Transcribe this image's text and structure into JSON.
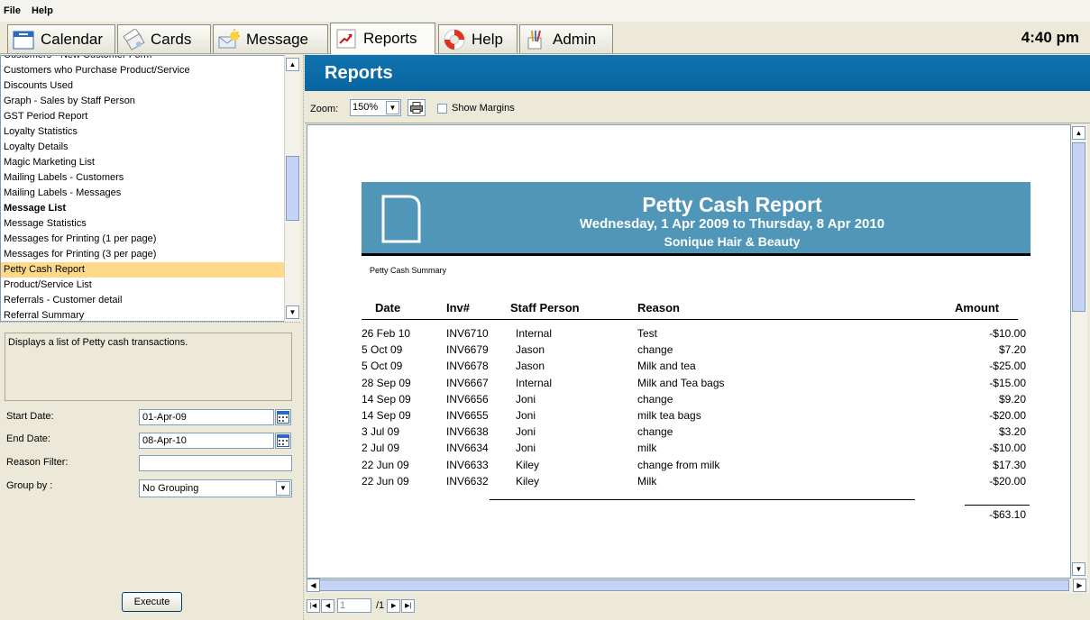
{
  "menu": [
    "File",
    "Help"
  ],
  "tabs": [
    {
      "label": "Calendar",
      "icon": "calendar-icon"
    },
    {
      "label": "Cards",
      "icon": "cards-icon"
    },
    {
      "label": "Message",
      "icon": "message-icon"
    },
    {
      "label": "Reports",
      "icon": "reports-icon",
      "active": true
    },
    {
      "label": "Help",
      "icon": "lifebuoy-icon"
    },
    {
      "label": "Admin",
      "icon": "admin-icon"
    }
  ],
  "clock": "4:40 pm",
  "report_list": [
    "Customers - New Customer Form",
    "Customers who Purchase Product/Service",
    "Discounts Used",
    "Graph - Sales by Staff Person",
    "GST Period Report",
    "Loyalty Statistics",
    "Loyalty Details",
    "Magic Marketing List",
    "Mailing Labels - Customers",
    "Mailing Labels - Messages",
    "Message List",
    "Message Statistics",
    "Messages for Printing (1 per page)",
    "Messages for Printing (3 per page)",
    "Petty Cash Report",
    "Product/Service List",
    "Referrals - Customer detail",
    "Referral Summary"
  ],
  "selected_report": "Petty Cash Report",
  "description": "Displays a list of Petty cash transactions.",
  "form": {
    "start_label": "Start Date:",
    "start_value": "01-Apr-09",
    "end_label": "End Date:",
    "end_value": "08-Apr-10",
    "reason_label": "Reason Filter:",
    "reason_value": "",
    "group_label": "Group by :",
    "group_value": "No Grouping"
  },
  "execute_label": "Execute",
  "reports_title": "Reports",
  "zoom": {
    "label": "Zoom:",
    "value": "150%",
    "margins_label": "Show Margins"
  },
  "pager": {
    "page": "1",
    "of": "/1"
  },
  "report": {
    "title": "Petty Cash Report",
    "daterange": "Wednesday, 1 Apr 2009 to Thursday, 8 Apr 2010",
    "business": "Sonique Hair & Beauty",
    "summary_label": "Petty Cash Summary",
    "columns": [
      "Date",
      "Inv#",
      "Staff Person",
      "Reason",
      "Amount"
    ],
    "rows": [
      [
        "26 Feb 10",
        "INV6710",
        "Internal",
        "Test",
        "-$10.00"
      ],
      [
        "5 Oct 09",
        "INV6679",
        "Jason",
        "change",
        "$7.20"
      ],
      [
        "5 Oct 09",
        "INV6678",
        "Jason",
        "Milk and tea",
        "-$25.00"
      ],
      [
        "28 Sep 09",
        "INV6667",
        "Internal",
        "Milk and Tea bags",
        "-$15.00"
      ],
      [
        "14 Sep 09",
        "INV6656",
        "Joni",
        "change",
        "$9.20"
      ],
      [
        "14 Sep 09",
        "INV6655",
        "Joni",
        "milk tea bags",
        "-$20.00"
      ],
      [
        "3 Jul 09",
        "INV6638",
        "Joni",
        "change",
        "$3.20"
      ],
      [
        "2 Jul 09",
        "INV6634",
        "Joni",
        "milk",
        "-$10.00"
      ],
      [
        "22 Jun 09",
        "INV6633",
        "Kiley",
        "change from milk",
        "$17.30"
      ],
      [
        "22 Jun 09",
        "INV6632",
        "Kiley",
        "Milk",
        "-$20.00"
      ]
    ],
    "total": "-$63.10"
  }
}
